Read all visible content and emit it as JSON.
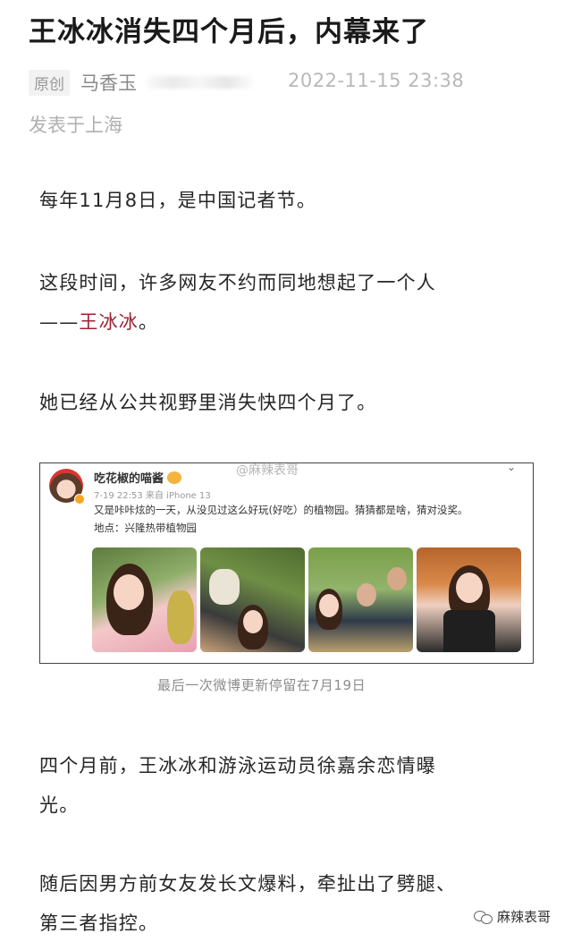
{
  "article": {
    "title": "王冰冰消失四个月后，内幕来了",
    "original_badge": "原创",
    "author": "马香玉",
    "date": "2022-11-15 23:38",
    "location": "发表于上海"
  },
  "paragraphs": {
    "p1": "每年11月8日，是中国记者节。",
    "p2_line1": "这段时间，许多网友不约而同地想起了一个人",
    "p2_line2_prefix": "——",
    "p2_line2_highlight": "王冰冰",
    "p2_line2_suffix": "。",
    "p3": "她已经从公共视野里消失快四个月了。",
    "p4_line1": "四个月前，王冰冰和游泳运动员徐嘉余恋情曝",
    "p4_line2": "光。",
    "p5_line1": "随后因男方前女友发长文爆料，牵扯出了劈腿、",
    "p5_line2": "第三者指控。"
  },
  "weibo_card": {
    "username": "吃花椒的喵酱",
    "time": "7-19 22:53 来自 iPhone 13",
    "text": "又是咔咔炫的一天，从没见过这么好玩(好吃）的植物园。猜猜都是啥，猜对没奖。",
    "location": "地点：兴隆热带植物园",
    "menu_icon": "chevron-down-icon",
    "photos": [
      "photo-1",
      "photo-2",
      "photo-3",
      "photo-4"
    ]
  },
  "caption": "最后一次微博更新停留在7月19日",
  "watermarks": {
    "weibo": "@麻辣表哥",
    "wechat": "麻辣表哥"
  },
  "colors": {
    "highlight": "#9e2233",
    "meta_gray": "#b8b8b8"
  }
}
